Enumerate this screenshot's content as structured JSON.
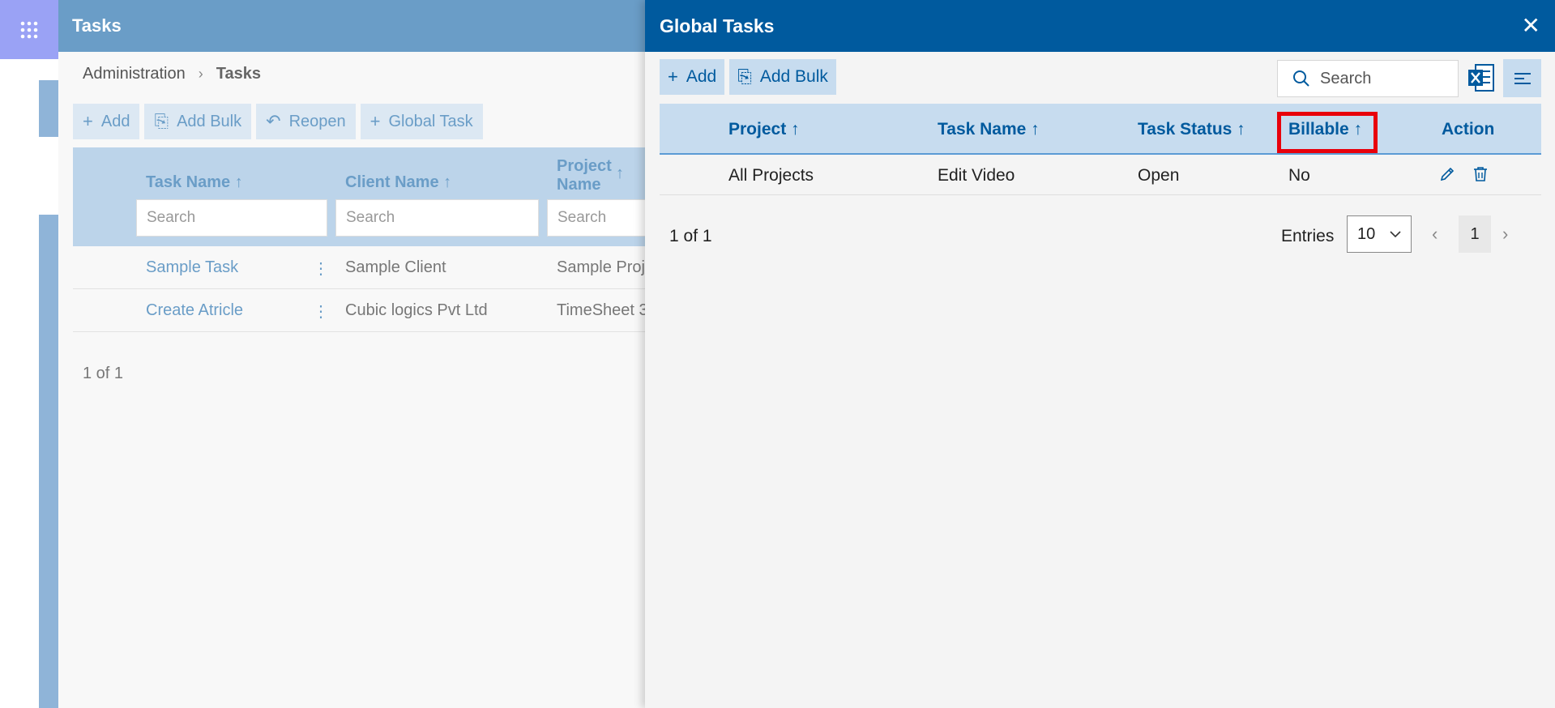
{
  "background_page": {
    "title": "Tasks",
    "breadcrumb": {
      "parent": "Administration",
      "separator": "›",
      "current": "Tasks"
    },
    "toolbar": [
      {
        "icon": "+",
        "label": "Add"
      },
      {
        "icon": "⎘",
        "label": "Add Bulk"
      },
      {
        "icon": "↶",
        "label": "Reopen"
      },
      {
        "icon": "+",
        "label": "Global Task"
      }
    ],
    "columns": {
      "task_name": "Task Name ↑",
      "client_name": "Client Name ↑",
      "project_name_line1": "Project",
      "project_name_line2": "Name",
      "project_sort": "↑"
    },
    "search_placeholder": "Search",
    "rows": [
      {
        "task": "Sample Task",
        "client": "Sample Client",
        "project": "Sample Proj"
      },
      {
        "task": "Create Atricle",
        "client": "Cubic logics Pvt Ltd",
        "project": "TimeSheet 3"
      }
    ],
    "row_menu": "⋮",
    "pager": "1 of 1"
  },
  "panel": {
    "title": "Global Tasks",
    "close": "✕",
    "toolbar": {
      "add": "Add",
      "add_icon": "+",
      "add_bulk": "Add Bulk",
      "add_bulk_icon": "⎘"
    },
    "search_placeholder": "Search",
    "columns": {
      "project": "Project ↑",
      "task_name": "Task Name ↑",
      "task_status": "Task Status ↑",
      "billable": "Billable ↑",
      "action": "Action"
    },
    "rows": [
      {
        "project": "All Projects",
        "task_name": "Edit Video",
        "task_status": "Open",
        "billable": "No"
      }
    ],
    "pager_text": "1 of 1",
    "entries_label": "Entries",
    "entries_value": "10",
    "current_page": "1",
    "prev": "‹",
    "next": "›"
  },
  "colors": {
    "panel_header": "#005a9e",
    "grid_header": "#c7dcef",
    "highlight": "#e8000b",
    "bg_header": "#6a9dc7"
  }
}
